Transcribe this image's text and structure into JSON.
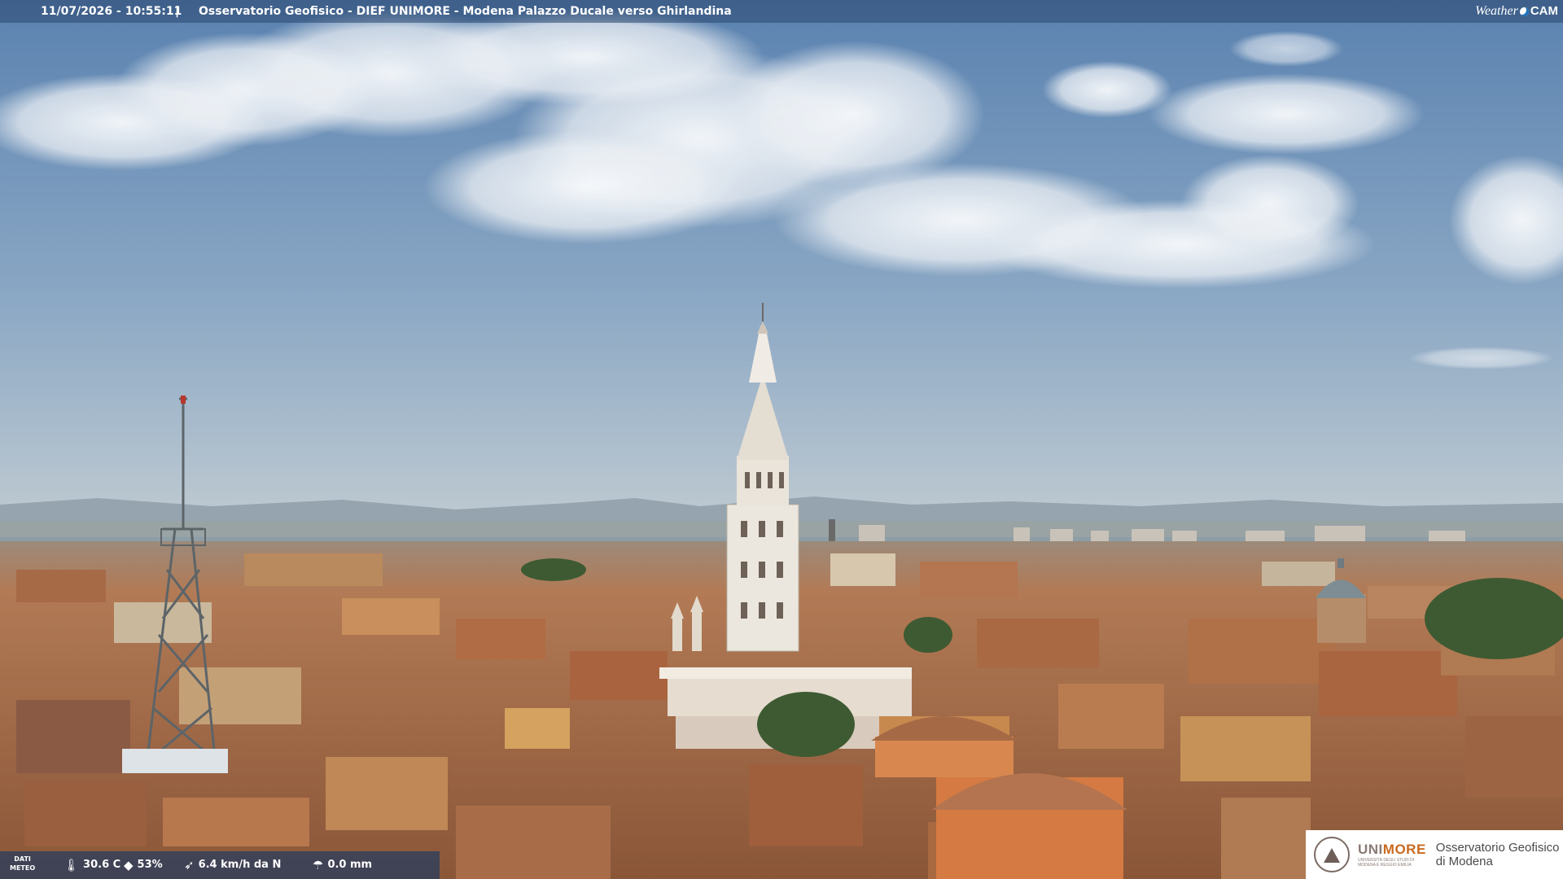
{
  "header": {
    "timestamp": "11/07/2026 - 10:55:11",
    "separator": "|",
    "caption": "Osservatorio Geofisico - DIEF UNIMORE - Modena Palazzo Ducale verso Ghirlandina"
  },
  "brand_logo": {
    "weather": "Weather",
    "cam": "CAM"
  },
  "weather": {
    "label_line1": "DATI",
    "label_line2": "METEO",
    "temperature": "30.6 C",
    "humidity": "53%",
    "wind": "6.4 km/h da N",
    "rain": "0.0 mm",
    "icons": {
      "temperature": "thermometer-icon",
      "humidity": "droplet-icon",
      "wind": "wind-icon",
      "rain": "rain-gauge-icon"
    }
  },
  "institution": {
    "uni_prefix": "UNI",
    "uni_suffix": "MORE",
    "uni_subtitle_1": "UNIVERSITÀ DEGLI STUDI DI",
    "uni_subtitle_2": "MODENA E REGGIO EMILIA",
    "observatory_line1": "Osservatorio Geofisico",
    "observatory_line2": "di Modena"
  },
  "colors": {
    "sky_top": "#5f86b2",
    "sky_horizon": "#b8c8d4",
    "roof": "#b9764d",
    "tower": "#e9e4dc",
    "more_orange": "#c96a1f"
  }
}
